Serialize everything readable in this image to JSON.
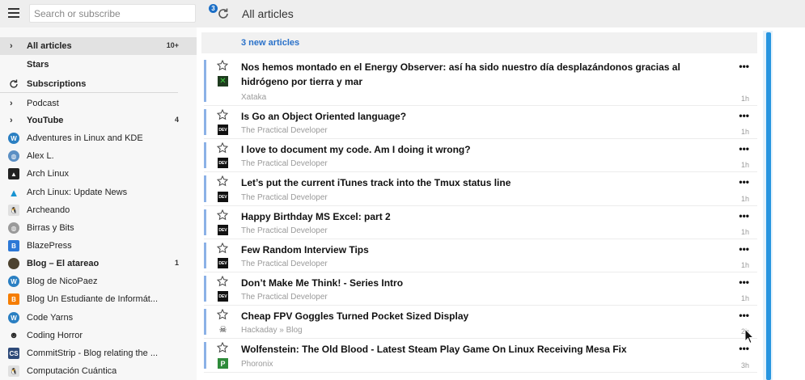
{
  "header": {
    "search_placeholder": "Search or subscribe",
    "refresh_badge": "3",
    "title": "All articles"
  },
  "sidebar": {
    "items": [
      {
        "label": "All articles",
        "count": "10+",
        "chevron": "›",
        "icon": ""
      },
      {
        "label": "Stars",
        "count": "",
        "chevron": "",
        "icon": ""
      },
      {
        "label": "Subscriptions",
        "count": "",
        "chevron": "",
        "icon": "refresh-icon"
      },
      {
        "label": "Podcast",
        "count": "",
        "chevron": "›",
        "icon": ""
      },
      {
        "label": "YouTube",
        "count": "4",
        "chevron": "›",
        "icon": ""
      },
      {
        "label": "Adventures in Linux and KDE",
        "count": "",
        "chevron": "",
        "icon": "wordpress-icon"
      },
      {
        "label": "Alex L.",
        "count": "",
        "chevron": "",
        "icon": "globe-icon"
      },
      {
        "label": "Arch Linux",
        "count": "",
        "chevron": "",
        "icon": "arch-icon"
      },
      {
        "label": "Arch Linux: Update News",
        "count": "",
        "chevron": "",
        "icon": "arch-blue-icon"
      },
      {
        "label": "Archeando",
        "count": "",
        "chevron": "",
        "icon": "tux-icon"
      },
      {
        "label": "Birras y Bits",
        "count": "",
        "chevron": "",
        "icon": "globe-icon"
      },
      {
        "label": "BlazePress",
        "count": "",
        "chevron": "",
        "icon": "b-icon"
      },
      {
        "label": "Blog – El atareao",
        "count": "1",
        "chevron": "",
        "icon": "avatar-icon"
      },
      {
        "label": "Blog de NicoPaez",
        "count": "",
        "chevron": "",
        "icon": "wordpress-icon"
      },
      {
        "label": "Blog Un Estudiante de Informát...",
        "count": "",
        "chevron": "",
        "icon": "blogger-icon"
      },
      {
        "label": "Code Yarns",
        "count": "",
        "chevron": "",
        "icon": "wordpress-icon"
      },
      {
        "label": "Coding Horror",
        "count": "",
        "chevron": "",
        "icon": "horror-icon"
      },
      {
        "label": "CommitStrip - Blog relating the ...",
        "count": "",
        "chevron": "",
        "icon": "cs-icon"
      },
      {
        "label": "Computación Cuántica",
        "count": "",
        "chevron": "",
        "icon": "tux-icon"
      }
    ]
  },
  "main": {
    "new_articles": "3 new articles",
    "articles": [
      {
        "title": "Nos hemos montado en el Energy Observer: así ha sido nuestro día desplazándonos gracias al hidrógeno por tierra y mar",
        "source": "Xataka",
        "time": "1h",
        "icon": "xataka-icon"
      },
      {
        "title": "Is Go an Object Oriented language?",
        "source": "The Practical Developer",
        "time": "1h",
        "icon": "dev-icon"
      },
      {
        "title": "I love to document my code. Am I doing it wrong?",
        "source": "The Practical Developer",
        "time": "1h",
        "icon": "dev-icon"
      },
      {
        "title": "Let’s put the current iTunes track into the Tmux status line",
        "source": "The Practical Developer",
        "time": "1h",
        "icon": "dev-icon"
      },
      {
        "title": "Happy Birthday MS Excel: part 2",
        "source": "The Practical Developer",
        "time": "1h",
        "icon": "dev-icon"
      },
      {
        "title": "Few Random Interview Tips",
        "source": "The Practical Developer",
        "time": "1h",
        "icon": "dev-icon"
      },
      {
        "title": "Don’t Make Me Think! - Series Intro",
        "source": "The Practical Developer",
        "time": "1h",
        "icon": "dev-icon"
      },
      {
        "title": "Cheap FPV Goggles Turned Pocket Sized Display",
        "source": "Hackaday » Blog",
        "time": "2h",
        "icon": "hackaday-icon"
      },
      {
        "title": "Wolfenstein: The Old Blood - Latest Steam Play Game On Linux Receiving Mesa Fix",
        "source": "Phoronix",
        "time": "3h",
        "icon": "phoronix-icon"
      }
    ],
    "more_label": "•••"
  },
  "colors": {
    "accent": "#2a71c9",
    "scrollbar": "#2795e0",
    "unread_bar": "#8bb1e6"
  }
}
